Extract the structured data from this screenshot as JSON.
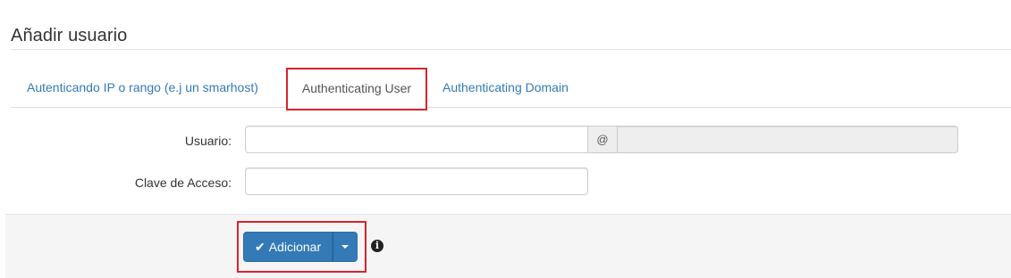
{
  "page": {
    "title": "Añadir usuario"
  },
  "tabs": [
    {
      "label": "Autenticando IP o rango (e.j un smarhost)",
      "active": false
    },
    {
      "label": "Authenticating User",
      "active": true
    },
    {
      "label": "Authenticating Domain",
      "active": false
    }
  ],
  "form": {
    "user_label": "Usuario:",
    "user_value": "",
    "at_symbol": "@",
    "domain_value": "",
    "password_label": "Clave de Acceso:",
    "password_value": ""
  },
  "footer": {
    "submit_label": "Adicionar",
    "submit_icon": "check-icon",
    "dropdown_icon": "caret-down-icon",
    "info_icon": "info-icon",
    "info_glyph": "i"
  },
  "colors": {
    "primary": "#337ab7",
    "link": "#337ab7",
    "highlight": "#d9232d",
    "footer_bg": "#f5f5f5"
  }
}
